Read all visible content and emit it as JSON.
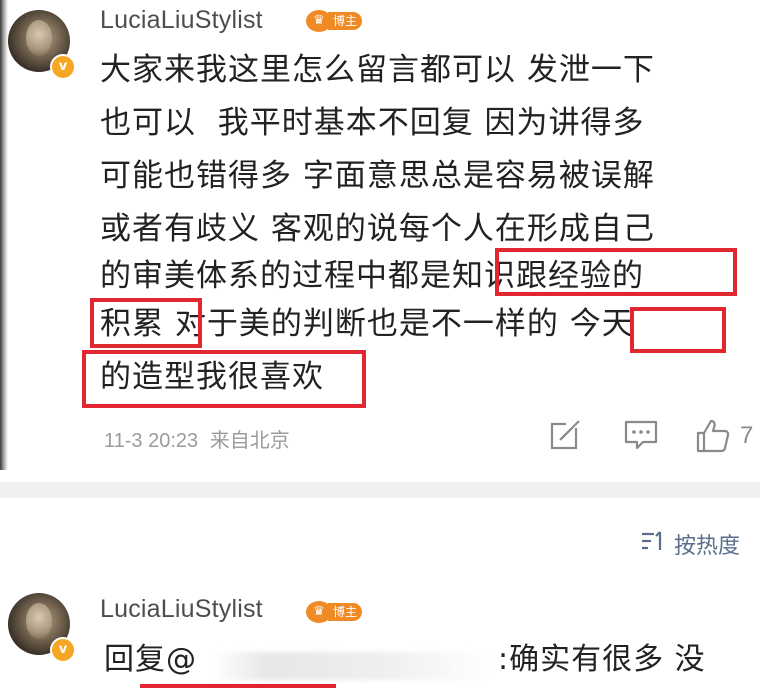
{
  "comment1": {
    "username": "LuciaLiuStylist",
    "badge_label": "博主",
    "verified_mark": "v",
    "lines": [
      "大家来我这里怎么留言都可以 发泄一下",
      "也可以  我平时基本不回复 因为讲得多",
      "可能也错得多 字面意思总是容易被误解",
      "或者有歧义 客观的说每个人在形成自己",
      "的审美体系的过程中都是知识跟经验的",
      "积累 对于美的判断也是不一样的 今天",
      "的造型我很喜欢"
    ],
    "timestamp": "11-3 20:23",
    "source": "来自北京",
    "like_count": "7",
    "icons": [
      "share-icon",
      "comment-icon",
      "like-icon"
    ]
  },
  "sort": {
    "icon": "sort-icon",
    "label": "按热度"
  },
  "comment2": {
    "username": "LuciaLiuStylist",
    "badge_label": "博主",
    "verified_mark": "v",
    "text_start": "回复@",
    "text_end": ":确实有很多 没"
  },
  "colors": {
    "highlight_box": "#e0262e",
    "username": "#4d4d4d",
    "meta": "#9b9b9b",
    "badge": "#f08a24",
    "sort_link": "#5a6e8c"
  }
}
